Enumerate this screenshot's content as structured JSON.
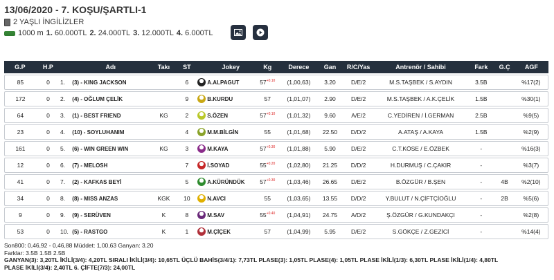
{
  "race": {
    "title": "13/06/2020 - 7. KOŞU/ŞARTLI-1",
    "subtitle": "2 YAŞLI İNGİLİZLER",
    "distance": "1000 m",
    "prizes": [
      {
        "rank": "1.",
        "amount": "60.000TL"
      },
      {
        "rank": "2.",
        "amount": "24.000TL"
      },
      {
        "rank": "3.",
        "amount": "12.000TL"
      },
      {
        "rank": "4.",
        "amount": "6.000TL"
      }
    ]
  },
  "icons": {
    "document": "document-icon",
    "track": "track-icon",
    "image": "image-icon",
    "video": "play-icon"
  },
  "columns": [
    "G.P",
    "H.P",
    "",
    "Adı",
    "Takı",
    "ST",
    "",
    "Jokey",
    "Kg",
    "Derece",
    "Gan",
    "R/C/Yas",
    "Antrenör / Sahibi",
    "Fark",
    "G.Ç",
    "AGF"
  ],
  "rows": [
    {
      "gp": "85",
      "hp": "0",
      "pos": "1.",
      "name": "(3) - KING JACKSON",
      "taki": "",
      "st": "6",
      "silk": "#222222",
      "jokey": "A.ALPAGUT",
      "kg": "57",
      "kg_sup": "+0.10",
      "derece": "(1,00,63)",
      "gan": "3.20",
      "rcy": "D/E/2",
      "trainer": "M.S.TAŞBEK / S.AYDIN",
      "fark": "3.5B",
      "gc": "",
      "agf": "%17(2)"
    },
    {
      "gp": "172",
      "hp": "0",
      "pos": "2.",
      "name": "(4) - OĞLUM ÇELİK",
      "taki": "",
      "st": "9",
      "silk": "#c9a814",
      "jokey": "B.KURDU",
      "kg": "57",
      "kg_sup": "",
      "derece": "(1,01,07)",
      "gan": "2.90",
      "rcy": "D/E/2",
      "trainer": "M.S.TAŞBEK / A.K.ÇELİK",
      "fark": "1.5B",
      "gc": "",
      "agf": "%30(1)"
    },
    {
      "gp": "64",
      "hp": "0",
      "pos": "3.",
      "name": "(1) - BEST FRIEND",
      "taki": "KG",
      "st": "2",
      "silk": "#b9c82a",
      "jokey": "S.ÖZEN",
      "kg": "57",
      "kg_sup": "+0.10",
      "derece": "(1,01,32)",
      "gan": "9.60",
      "rcy": "A/E/2",
      "trainer": "C.YEDİREN / İ.GERMAN",
      "fark": "2.5B",
      "gc": "",
      "agf": "%9(5)"
    },
    {
      "gp": "23",
      "hp": "0",
      "pos": "4.",
      "name": "(10) - SOYLUHANIM",
      "taki": "",
      "st": "4",
      "silk": "#8aa32a",
      "jokey": "M.M.BİLGİN",
      "kg": "55",
      "kg_sup": "",
      "derece": "(1,01,68)",
      "gan": "22.50",
      "rcy": "D/D/2",
      "trainer": "A.ATAŞ / A.KAYA",
      "fark": "1.5B",
      "gc": "",
      "agf": "%2(9)"
    },
    {
      "gp": "161",
      "hp": "0",
      "pos": "5.",
      "name": "(6) - WIN GREEN WIN",
      "taki": "KG",
      "st": "3",
      "silk": "#8a2c8a",
      "jokey": "M.KAYA",
      "kg": "57",
      "kg_sup": "+0.30",
      "derece": "(1,01,88)",
      "gan": "5.90",
      "rcy": "D/E/2",
      "trainer": "C.T.KÖSE / E.ÖZBEK",
      "fark": "-",
      "gc": "",
      "agf": "%16(3)"
    },
    {
      "gp": "12",
      "hp": "0",
      "pos": "6.",
      "name": "(7) - MELOSH",
      "taki": "",
      "st": "7",
      "silk": "#c62828",
      "jokey": "İ.SOYAD",
      "kg": "55",
      "kg_sup": "+0.20",
      "derece": "(1,02,80)",
      "gan": "21.25",
      "rcy": "D/D/2",
      "trainer": "H.DURMUŞ / C.ÇAKIR",
      "fark": "-",
      "gc": "",
      "agf": "%3(7)"
    },
    {
      "gp": "41",
      "hp": "0",
      "pos": "7.",
      "name": "(2) - KAFKAS BEYİ",
      "taki": "",
      "st": "5",
      "silk": "#2e8b2e",
      "jokey": "A.KÜRÜNDÜK",
      "kg": "57",
      "kg_sup": "+0.30",
      "derece": "(1,03,46)",
      "gan": "26.65",
      "rcy": "D/E/2",
      "trainer": "B.ÖZGÜR / B.ŞEN",
      "fark": "-",
      "gc": "4B",
      "agf": "%2(10)"
    },
    {
      "gp": "34",
      "hp": "0",
      "pos": "8.",
      "name": "(8) - MISS ANZAS",
      "taki": "KGK",
      "st": "10",
      "silk": "#e0b000",
      "jokey": "N.AVCI",
      "kg": "55",
      "kg_sup": "",
      "derece": "(1,03,65)",
      "gan": "13.55",
      "rcy": "D/D/2",
      "trainer": "Y.BULUT / N.ÇİFTÇİOĞLU",
      "fark": "-",
      "gc": "2B",
      "agf": "%5(6)"
    },
    {
      "gp": "9",
      "hp": "0",
      "pos": "9.",
      "name": "(9) - SERÜVEN",
      "taki": "K",
      "st": "8",
      "silk": "#6a2a7a",
      "jokey": "M.SAV",
      "kg": "55",
      "kg_sup": "+0.40",
      "derece": "(1,04,91)",
      "gan": "24.75",
      "rcy": "A/D/2",
      "trainer": "Ş.ÖZGÜR / G.KUNDAKÇI",
      "fark": "-",
      "gc": "",
      "agf": "%2(8)"
    },
    {
      "gp": "53",
      "hp": "0",
      "pos": "10.",
      "name": "(5) - RASTGO",
      "taki": "K",
      "st": "1",
      "silk": "#b0303a",
      "jokey": "M.ÇİÇEK",
      "kg": "57",
      "kg_sup": "",
      "derece": "(1,04,99)",
      "gan": "5.95",
      "rcy": "D/E/2",
      "trainer": "S.GÖKÇE / Z.GEZİCİ",
      "fark": "-",
      "gc": "",
      "agf": "%14(4)"
    }
  ],
  "footer": {
    "line1": "Son800: 0,46,92 - 0,46,88 Müddet: 1,00,63 Ganyan: 3.20",
    "line2": "Farklar: 3.5B 1.5B 2.5B",
    "line3": "GANYAN(3): 3,20TL İKİLİ(3/4): 4,20TL SIRALI İKİLİ(3/4): 10,65TL ÜÇLÜ BAHİS(3/4/1): 7,73TL PLASE(3): 1,05TL PLASE(4): 1,05TL PLASE İKİLİ(1/3): 6,30TL PLASE İKİLİ(1/4): 4,80TL",
    "line4": "PLASE İKİLİ(3/4): 2,40TL 6. ÇİFTE(7/3): 24,00TL"
  }
}
